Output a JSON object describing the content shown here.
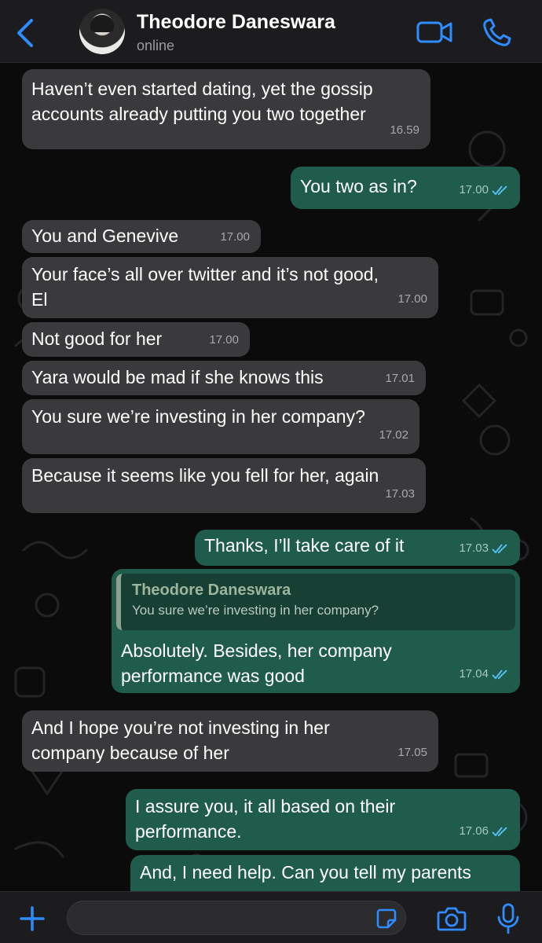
{
  "header": {
    "contact_name": "Theodore Daneswara",
    "status": "online",
    "accent": "#2f8cff"
  },
  "messages": [
    {
      "dir": "in",
      "text": "Haven’t even started dating, yet the gossip\naccounts already putting you two together",
      "time": "16.59"
    },
    {
      "dir": "out",
      "text": "You two as in?",
      "time": "17.00",
      "read": true
    },
    {
      "dir": "in",
      "text": "You and Genevive",
      "time": "17.00"
    },
    {
      "dir": "in",
      "text": "Your face’s all over twitter and it’s not good,\nEl",
      "time": "17.00"
    },
    {
      "dir": "in",
      "text": "Not good for her",
      "time": "17.00"
    },
    {
      "dir": "in",
      "text": "Yara would be mad if she knows this",
      "time": "17.01"
    },
    {
      "dir": "in",
      "text": "You sure we’re investing in her company?",
      "time": "17.02"
    },
    {
      "dir": "in",
      "text": "Because it seems like you fell for her, again",
      "time": "17.03"
    },
    {
      "dir": "out",
      "text": "Thanks, I’ll take care of it",
      "time": "17.03",
      "read": true
    },
    {
      "dir": "out",
      "text": "Absolutely. Besides, her company\nperformance was good",
      "time": "17.04",
      "read": true,
      "quote": {
        "name": "Theodore Daneswara",
        "text": "You sure we’re investing in her company?"
      }
    },
    {
      "dir": "in",
      "text": "And I hope you’re not investing in her\ncompany because of her",
      "time": "17.05"
    },
    {
      "dir": "out",
      "text": "I assure you, it all based on their\nperformance.",
      "time": "17.06",
      "read": true
    },
    {
      "dir": "out",
      "text": "And, I need help. Can you tell my parents",
      "time": "",
      "read": false
    }
  ],
  "input": {
    "value": "",
    "placeholder": ""
  },
  "colors": {
    "incoming_bubble": "#3a3a3c",
    "outgoing_bubble": "#1f5c4b",
    "read_ticks": "#53bdeb"
  },
  "icons": [
    "back-chevron-icon",
    "video-call-icon",
    "phone-call-icon",
    "plus-icon",
    "sticker-icon",
    "camera-icon",
    "microphone-icon"
  ]
}
